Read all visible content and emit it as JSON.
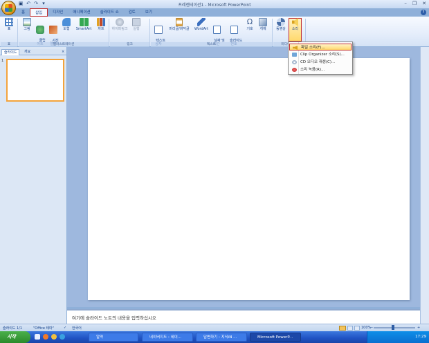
{
  "window": {
    "title": "프레젠테이션1 - Microsoft PowerPoint"
  },
  "quick_access": [
    {
      "icon": "save-icon",
      "glyph": "▣"
    },
    {
      "icon": "undo-icon",
      "glyph": "↶"
    },
    {
      "icon": "redo-icon",
      "glyph": "↷"
    },
    {
      "icon": "qat-more-icon",
      "glyph": "▾"
    }
  ],
  "window_controls": {
    "minimize": "–",
    "restore": "❐",
    "close": "✕"
  },
  "tabs": [
    "홈",
    "삽입",
    "디자인",
    "애니메이션",
    "슬라이드 쇼",
    "검토",
    "보기"
  ],
  "active_tab": "삽입",
  "help": "?",
  "ribbon": {
    "buttons": [
      {
        "label": "표",
        "icon": "table-icon",
        "color": "#4a7fc4"
      },
      {
        "label": "그림",
        "icon": "picture-icon",
        "color": "#6fa5d8"
      },
      {
        "label": "클립\n아트",
        "icon": "clipart-icon",
        "color": "#2e8b57"
      },
      {
        "label": "사진\n앨범",
        "icon": "photo-album-icon",
        "color": "#c8561f"
      },
      {
        "label": "도형",
        "icon": "shapes-icon",
        "color": "#4c8fd9"
      },
      {
        "label": "SmartArt",
        "icon": "smartart-icon",
        "color": "#35a853"
      },
      {
        "label": "차트",
        "icon": "chart-icon",
        "color": "#e0a125"
      },
      {
        "label": "하이퍼링크",
        "icon": "hyperlink-icon",
        "color": "#9aa6b8"
      },
      {
        "label": "실행",
        "icon": "action-icon",
        "color": "#9aa6b8"
      },
      {
        "label": "텍스트\n상자",
        "icon": "textbox-icon",
        "color": "#5b7fb5"
      },
      {
        "label": "머리글/바닥글",
        "icon": "header-footer-icon",
        "color": "#e2a84a"
      },
      {
        "label": "WordArt",
        "icon": "wordart-icon",
        "color": "#3b6fbf"
      },
      {
        "label": "날짜 및\n시간",
        "icon": "datetime-icon",
        "color": "#4f7bb8"
      },
      {
        "label": "슬라이드\n번호",
        "icon": "slide-number-icon",
        "color": "#4f7bb8"
      },
      {
        "label": "기호",
        "icon": "symbol-icon",
        "color": "#3f5f91"
      },
      {
        "label": "개체",
        "icon": "object-icon",
        "color": "#6f8fb8"
      },
      {
        "label": "동영상",
        "icon": "movie-icon",
        "color": "#4a6fa8"
      },
      {
        "label": "소리",
        "icon": "sound-icon",
        "color": "#d9a320"
      }
    ],
    "groups": [
      "표",
      "일러스트레이션",
      "링크",
      "텍스트",
      "미디어 클립"
    ]
  },
  "sound_menu": {
    "items": [
      {
        "label": "파일 소리(F)...",
        "icon": "speaker-icon"
      },
      {
        "label": "Clip Organizer 소리(S)...",
        "icon": "clip-organizer-icon"
      },
      {
        "label": "CD 오디오 재생(C)...",
        "icon": "cd-audio-icon"
      },
      {
        "label": "소리 녹음(R)...",
        "icon": "record-icon"
      }
    ]
  },
  "left_panel": {
    "tabs": [
      "슬라이드",
      "개요"
    ],
    "close": "×",
    "slide_number": "1"
  },
  "notes_placeholder": "여기에 슬라이드 노트의 내용을 입력하십시오",
  "status": {
    "slide_info": "슬라이드 1/1",
    "theme": "\"Office 테마\"",
    "language": "한국어",
    "zoom": "100%",
    "zoom_minus": "−",
    "zoom_plus": "+"
  },
  "taskbar": {
    "start": "시작",
    "items": [
      "알약",
      "네이버지도 : 네이...",
      "답변하기 : 지식iN ...",
      "Microsoft PowerP..."
    ],
    "active": 3,
    "clock": "17:29"
  },
  "colors": {
    "accent_red": "#c12e2e",
    "slide_thumb_border": "#f3a33b",
    "ribbon_bg": "#e6eefb"
  }
}
